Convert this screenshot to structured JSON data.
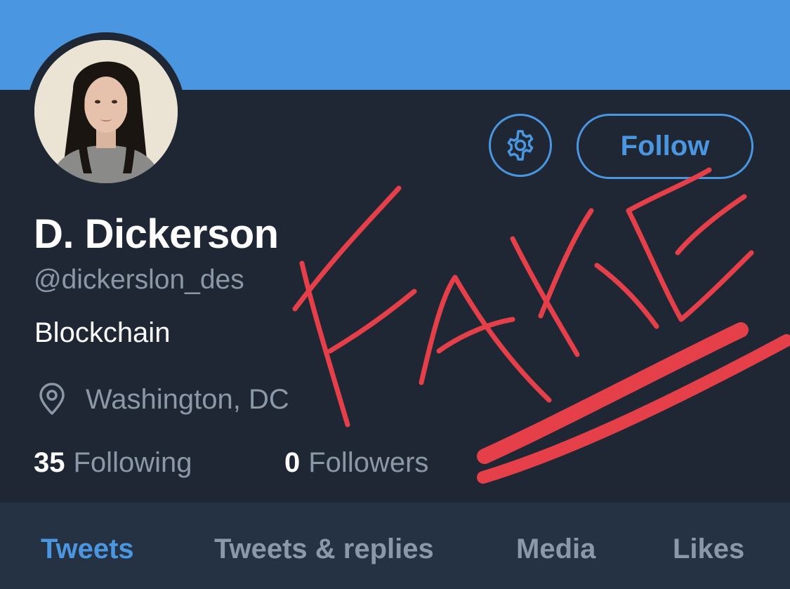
{
  "colors": {
    "accent": "#4a96e0",
    "background": "#1f2734",
    "secondary_text": "#8a98a8",
    "tabbar": "#253244",
    "annotation": "#e5404a"
  },
  "profile": {
    "display_name": "D. Dickerson",
    "handle": "@dickerslon_des",
    "bio": "Blockchain",
    "location": "Washington, DC",
    "location_icon": "location-pin-icon"
  },
  "actions": {
    "settings_icon": "gear-icon",
    "follow_label": "Follow"
  },
  "stats": {
    "following_count": "35",
    "following_label": "Following",
    "followers_count": "0",
    "followers_label": "Followers"
  },
  "tabs": [
    {
      "label": "Tweets",
      "active": true
    },
    {
      "label": "Tweets & replies",
      "active": false
    },
    {
      "label": "Media",
      "active": false
    },
    {
      "label": "Likes",
      "active": false
    }
  ],
  "annotation": {
    "text": "FAKE",
    "style": "hand-drawn red scribble with underline"
  }
}
